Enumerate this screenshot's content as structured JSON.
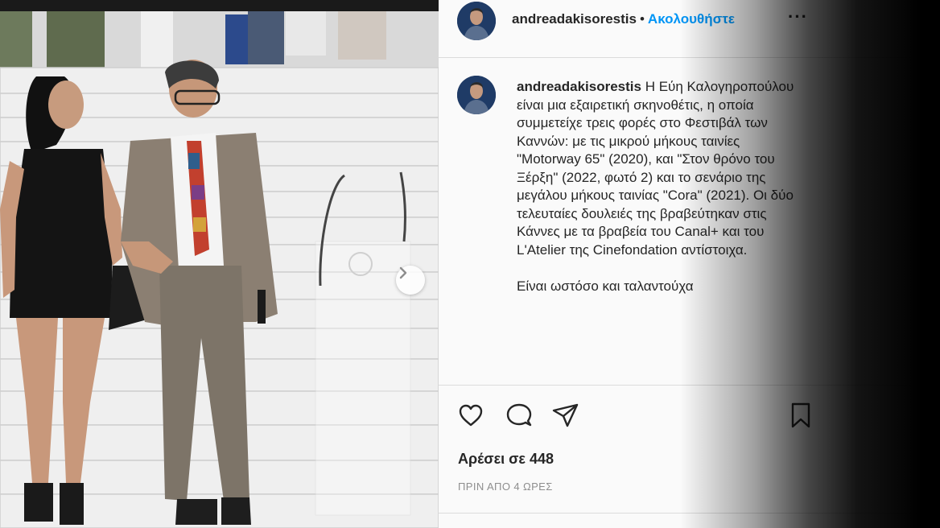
{
  "post": {
    "username": "andreadakisorestis",
    "separator": "•",
    "follow_label": "Ακολουθήστε",
    "more_label": "···",
    "caption_text": "Η Εύη Καλογηροπούλου είναι μια εξαιρετική σκηνοθέτις, η οποία συμμετείχε τρεις φορές στο Φεστιβάλ των Καννών: με τις μικρού μήκους ταινίες \"Motorway 65\" (2020), και \"Στον θρόνο του Ξέρξη\" (2022, φωτό 2) και το σενάριο της μεγάλου μήκους ταινίας \"Cora\" (2021). Οι δύο τελευταίες δουλειές της βραβεύτηκαν στις Κάννες με τα βραβεία του Canal+ και του L'Atelier της Cinefondation αντίστοιχα.\n\nΕίναι ωστόσο και ταλαντούχα",
    "likes": "Αρέσει σε 448",
    "time": "ΠΡΙΝ ΑΠΟ 4 ΩΡΕΣ"
  },
  "icons": {
    "like": "heart-icon",
    "comment": "comment-icon",
    "share": "paper-plane-icon",
    "save": "bookmark-icon",
    "next": "chevron-right-icon"
  },
  "colors": {
    "link_blue": "#0095f6",
    "text": "#262626",
    "muted": "#8e8e8e",
    "panel_bg": "#fafafa"
  }
}
